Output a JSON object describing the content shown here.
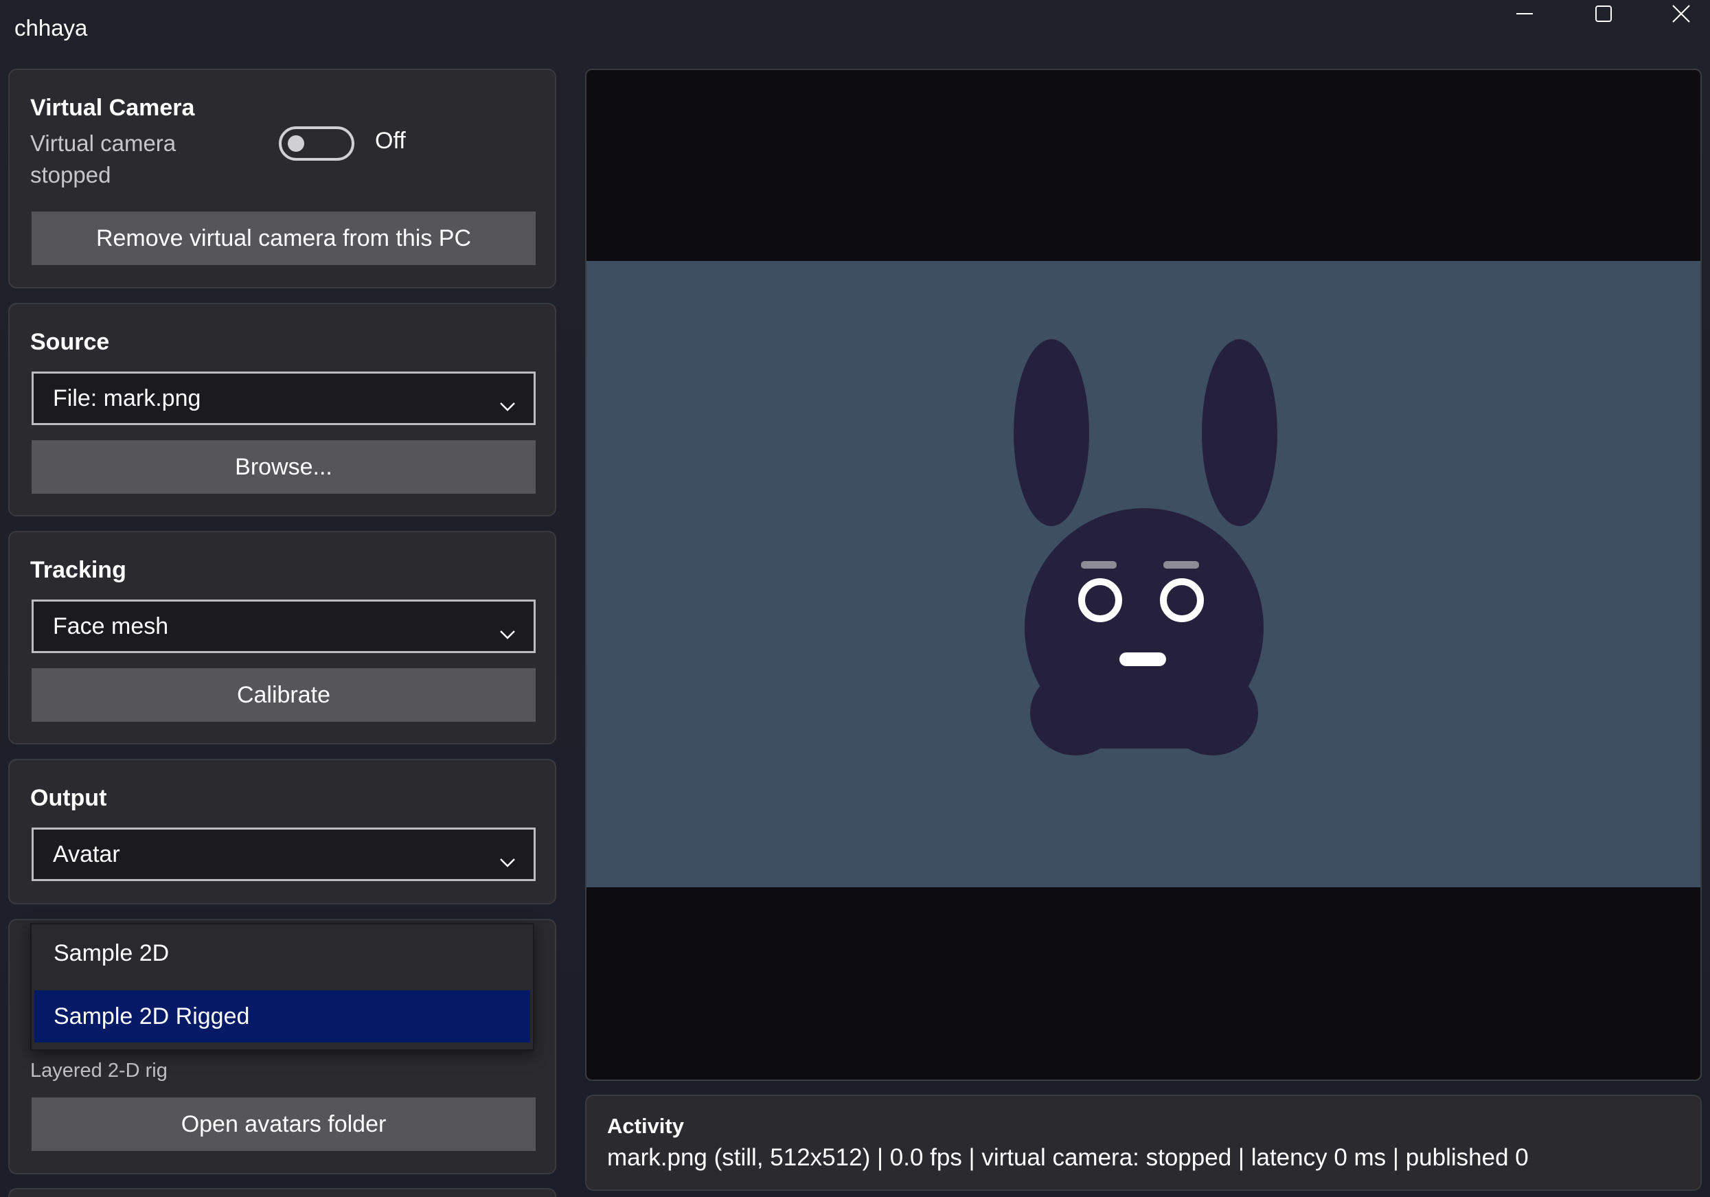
{
  "app": {
    "title": "chhaya"
  },
  "window_controls": {
    "minimize_icon": "minimize-icon",
    "maximize_icon": "maximize-icon",
    "close_icon": "close-icon"
  },
  "virtual_camera": {
    "title": "Virtual Camera",
    "status_line1": "Virtual camera",
    "status_line2": "stopped",
    "toggle_label": "Off",
    "toggle_on": false,
    "remove_button": "Remove virtual camera from this PC"
  },
  "source": {
    "title": "Source",
    "selected": "File: mark.png",
    "browse_button": "Browse..."
  },
  "tracking": {
    "title": "Tracking",
    "selected": "Face mesh",
    "calibrate_button": "Calibrate"
  },
  "output": {
    "title": "Output",
    "selected": "Avatar"
  },
  "avatar": {
    "options": [
      "Sample 2D",
      "Sample 2D Rigged"
    ],
    "selected_index": 1,
    "description": "Layered 2-D rig",
    "open_folder_button": "Open avatars folder"
  },
  "activity": {
    "title": "Activity",
    "status": "mark.png (still, 512x512)  |  0.0 fps  |  virtual camera: stopped  |  latency 0 ms  |  published 0"
  },
  "colors": {
    "preview_background": "#3d4f60",
    "avatar_body": "#25203b",
    "avatar_features": "#ffffff",
    "selection_highlight": "#041a66"
  }
}
